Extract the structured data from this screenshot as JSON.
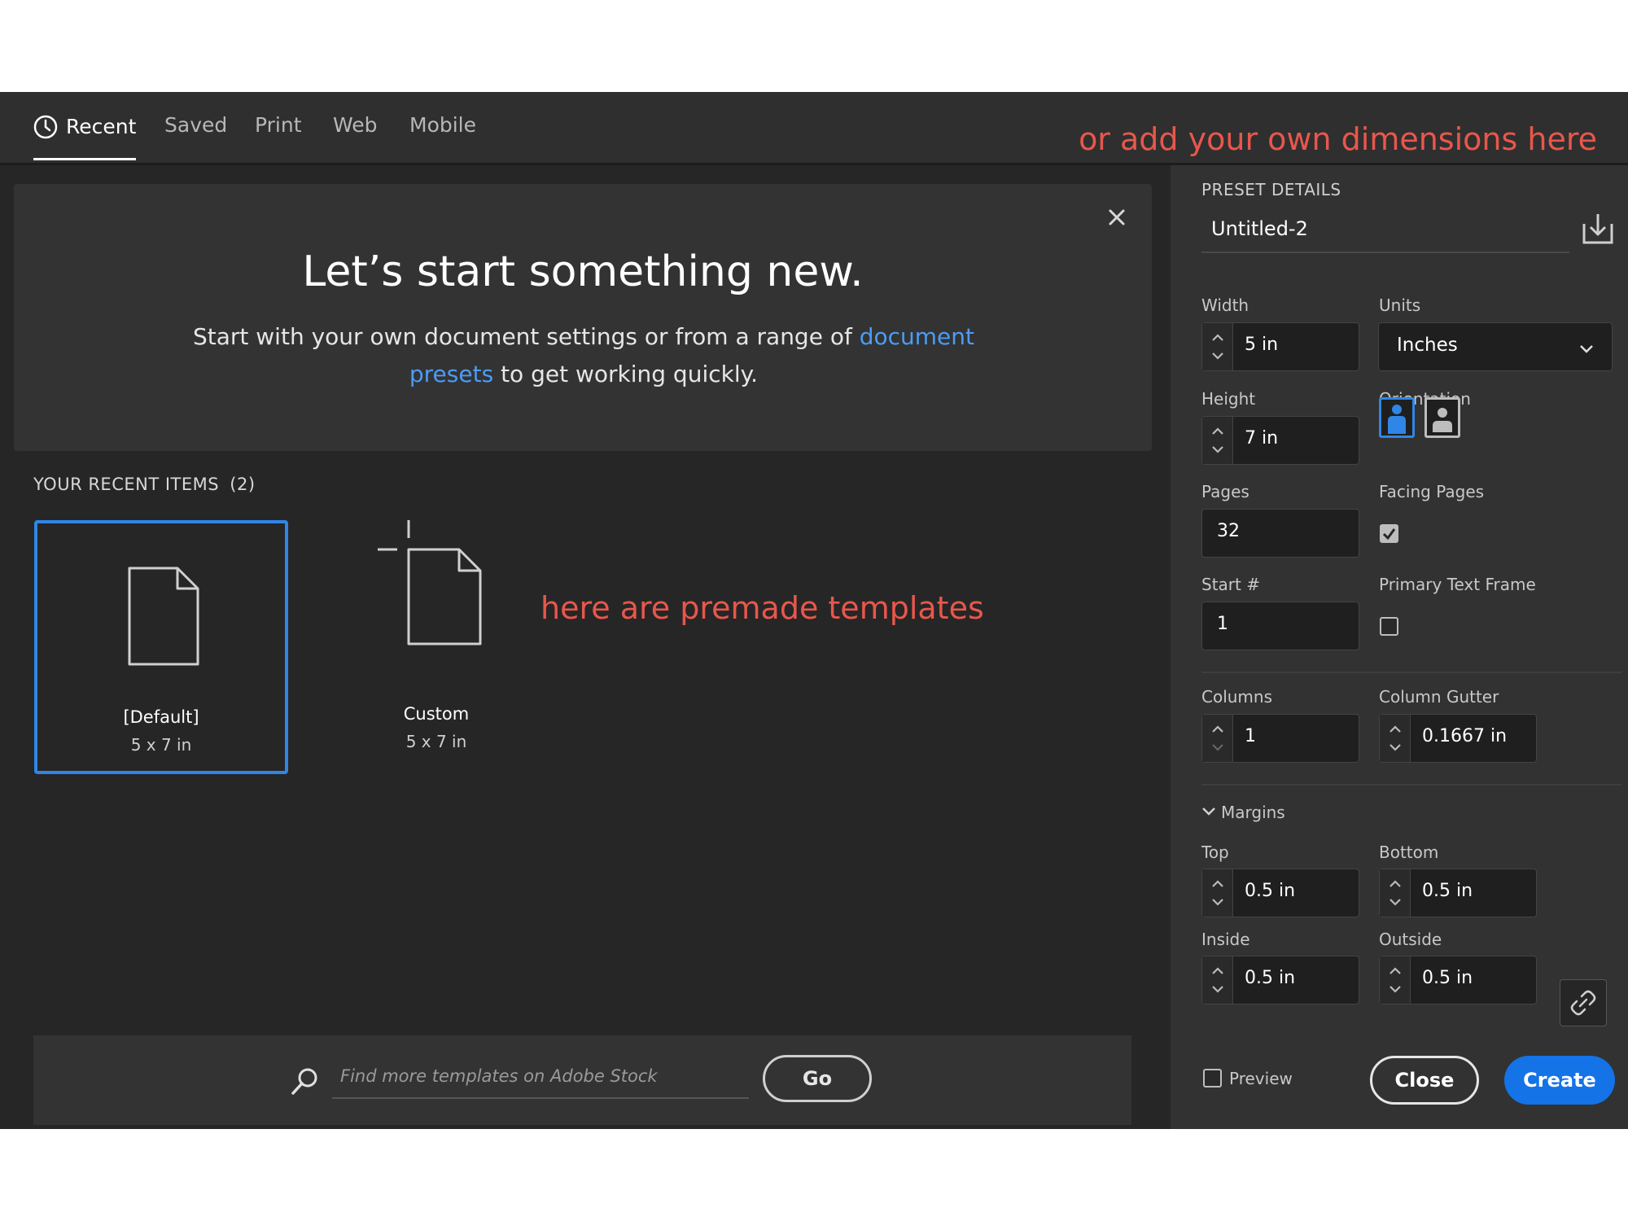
{
  "tabs": [
    {
      "label": "Recent",
      "active": true
    },
    {
      "label": "Saved"
    },
    {
      "label": "Print"
    },
    {
      "label": "Web"
    },
    {
      "label": "Mobile"
    }
  ],
  "annotations": {
    "top": "or add your own dimensions here",
    "middle": "here are premade templates"
  },
  "welcome": {
    "headline": "Let’s start something new.",
    "sub_before": "Start with your own document settings or from a range of ",
    "sub_link": "document presets",
    "sub_after": " to get working quickly."
  },
  "recent": {
    "title": "YOUR RECENT ITEMS",
    "count": "(2)",
    "items": [
      {
        "name": "[Default]",
        "dims": "5 x 7 in"
      },
      {
        "name": "Custom",
        "dims": "5 x 7 in"
      }
    ]
  },
  "search": {
    "placeholder": "Find more templates on Adobe Stock",
    "go_label": "Go"
  },
  "preset": {
    "section_title": "PRESET DETAILS",
    "document_name": "Untitled-2",
    "width_label": "Width",
    "width_value": "5 in",
    "units_label": "Units",
    "units_value": "Inches",
    "height_label": "Height",
    "height_value": "7 in",
    "orientation_label": "Orientation",
    "pages_label": "Pages",
    "pages_value": "32",
    "facing_pages_label": "Facing Pages",
    "facing_pages_checked": true,
    "start_label": "Start #",
    "start_value": "1",
    "primary_text_frame_label": "Primary Text Frame",
    "primary_text_frame_checked": false,
    "columns_label": "Columns",
    "columns_value": "1",
    "column_gutter_label": "Column Gutter",
    "column_gutter_value": "0.1667 in",
    "margins_label": "Margins",
    "top_label": "Top",
    "top_value": "0.5 in",
    "bottom_label": "Bottom",
    "bottom_value": "0.5 in",
    "inside_label": "Inside",
    "inside_value": "0.5 in",
    "outside_label": "Outside",
    "outside_value": "0.5 in",
    "preview_label": "Preview",
    "close_label": "Close",
    "create_label": "Create"
  },
  "colors": {
    "accent": "#1473e6",
    "selection": "#2f86e6",
    "annotation": "#e8574c",
    "link": "#4b9cf5"
  }
}
